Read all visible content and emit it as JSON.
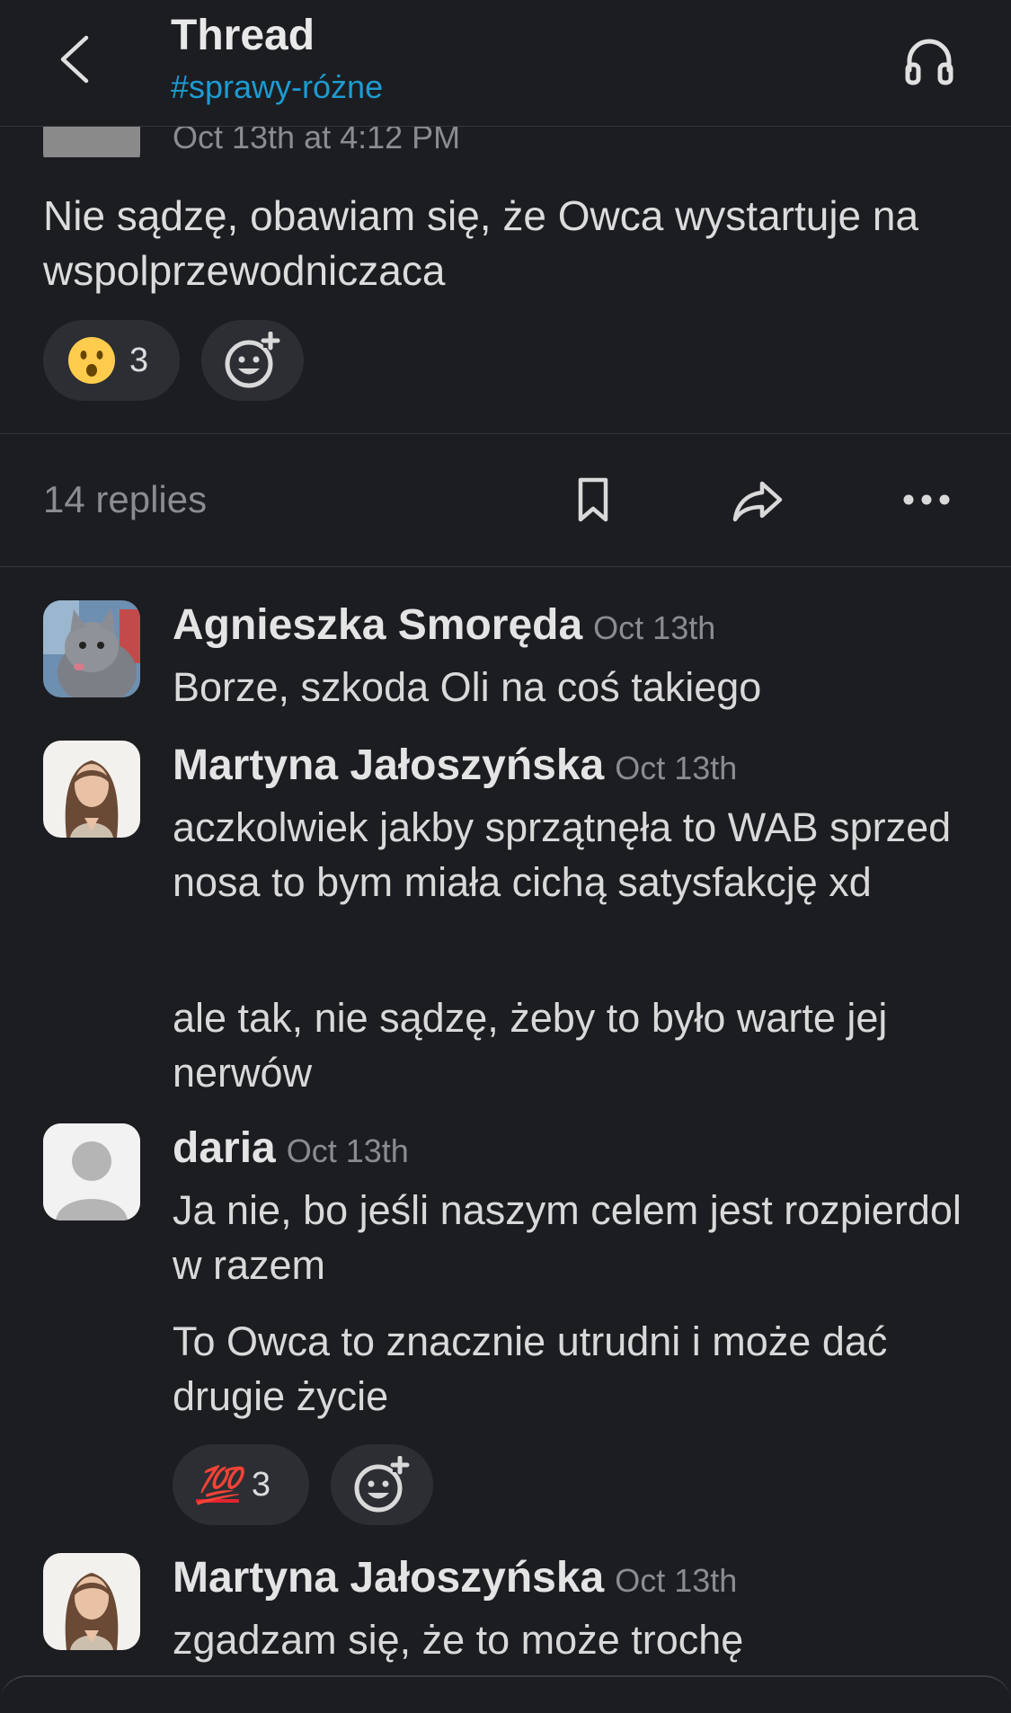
{
  "header": {
    "title": "Thread",
    "channel": "#sprawy-różne"
  },
  "parent": {
    "timestamp": "Oct 13th at 4:12 PM",
    "text": "Nie sądzę, obawiam się, że Owca wystartuje na wspolprzewodniczaca",
    "reaction": {
      "emoji": "hushed-face",
      "count": "3"
    }
  },
  "actions": {
    "replies": "14 replies"
  },
  "messages": [
    {
      "author": "Agnieszka Smoręda",
      "time": "Oct 13th",
      "lines": [
        "Borze, szkoda Oli na coś takiego"
      ]
    },
    {
      "author": "Martyna Jałoszyńska",
      "time": "Oct 13th",
      "lines": [
        "aczkolwiek jakby sprzątnęła to WAB sprzed nosa to bym miała cichą satysfakcję xd",
        "ale tak, nie sądzę, żeby to było warte jej nerwów"
      ]
    },
    {
      "author": "daria",
      "time": "Oct 13th",
      "lines": [
        "Ja nie, bo jeśli naszym celem jest rozpierdol w razem",
        "To Owca to znacznie utrudni i może dać drugie życie"
      ],
      "reaction": {
        "emoji": "💯",
        "count": "3"
      }
    },
    {
      "author": "Martyna Jałoszyńska",
      "time": "Oct 13th",
      "lines": [
        "zgadzam się, że to może trochę"
      ]
    }
  ],
  "colors": {
    "background": "#1b1d21",
    "link": "#1d9bd1",
    "pill": "#2c2e33",
    "muted": "#8b8c8f"
  }
}
